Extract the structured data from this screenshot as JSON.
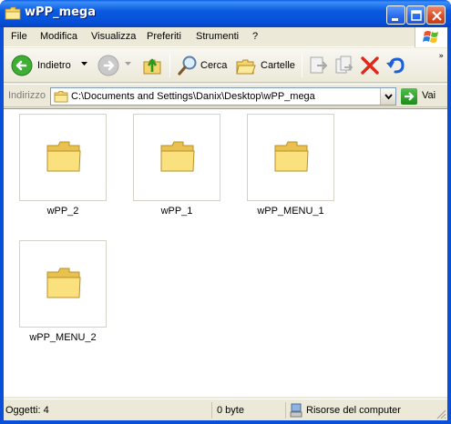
{
  "window": {
    "title": "wPP_mega"
  },
  "menubar": {
    "items": [
      "File",
      "Modifica",
      "Visualizza",
      "Preferiti",
      "Strumenti",
      "?"
    ]
  },
  "toolbar": {
    "back_label": "Indietro",
    "search_label": "Cerca",
    "folders_label": "Cartelle"
  },
  "address": {
    "label": "Indirizzo",
    "path": "C:\\Documents and Settings\\Danix\\Desktop\\wPP_mega",
    "go_label": "Vai"
  },
  "content": {
    "items": [
      {
        "name": "wPP_2",
        "icon": "folder-icon"
      },
      {
        "name": "wPP_1",
        "icon": "folder-icon"
      },
      {
        "name": "wPP_MENU_1",
        "icon": "folder-icon"
      },
      {
        "name": "wPP_MENU_2",
        "icon": "folder-icon"
      }
    ]
  },
  "statusbar": {
    "objects": "Oggetti: 4",
    "size": "0 byte",
    "zone": "Risorse del computer"
  },
  "colors": {
    "titlebar": "#0a5ae0",
    "frame": "#ece9d8",
    "folder": "#f5d66a"
  }
}
